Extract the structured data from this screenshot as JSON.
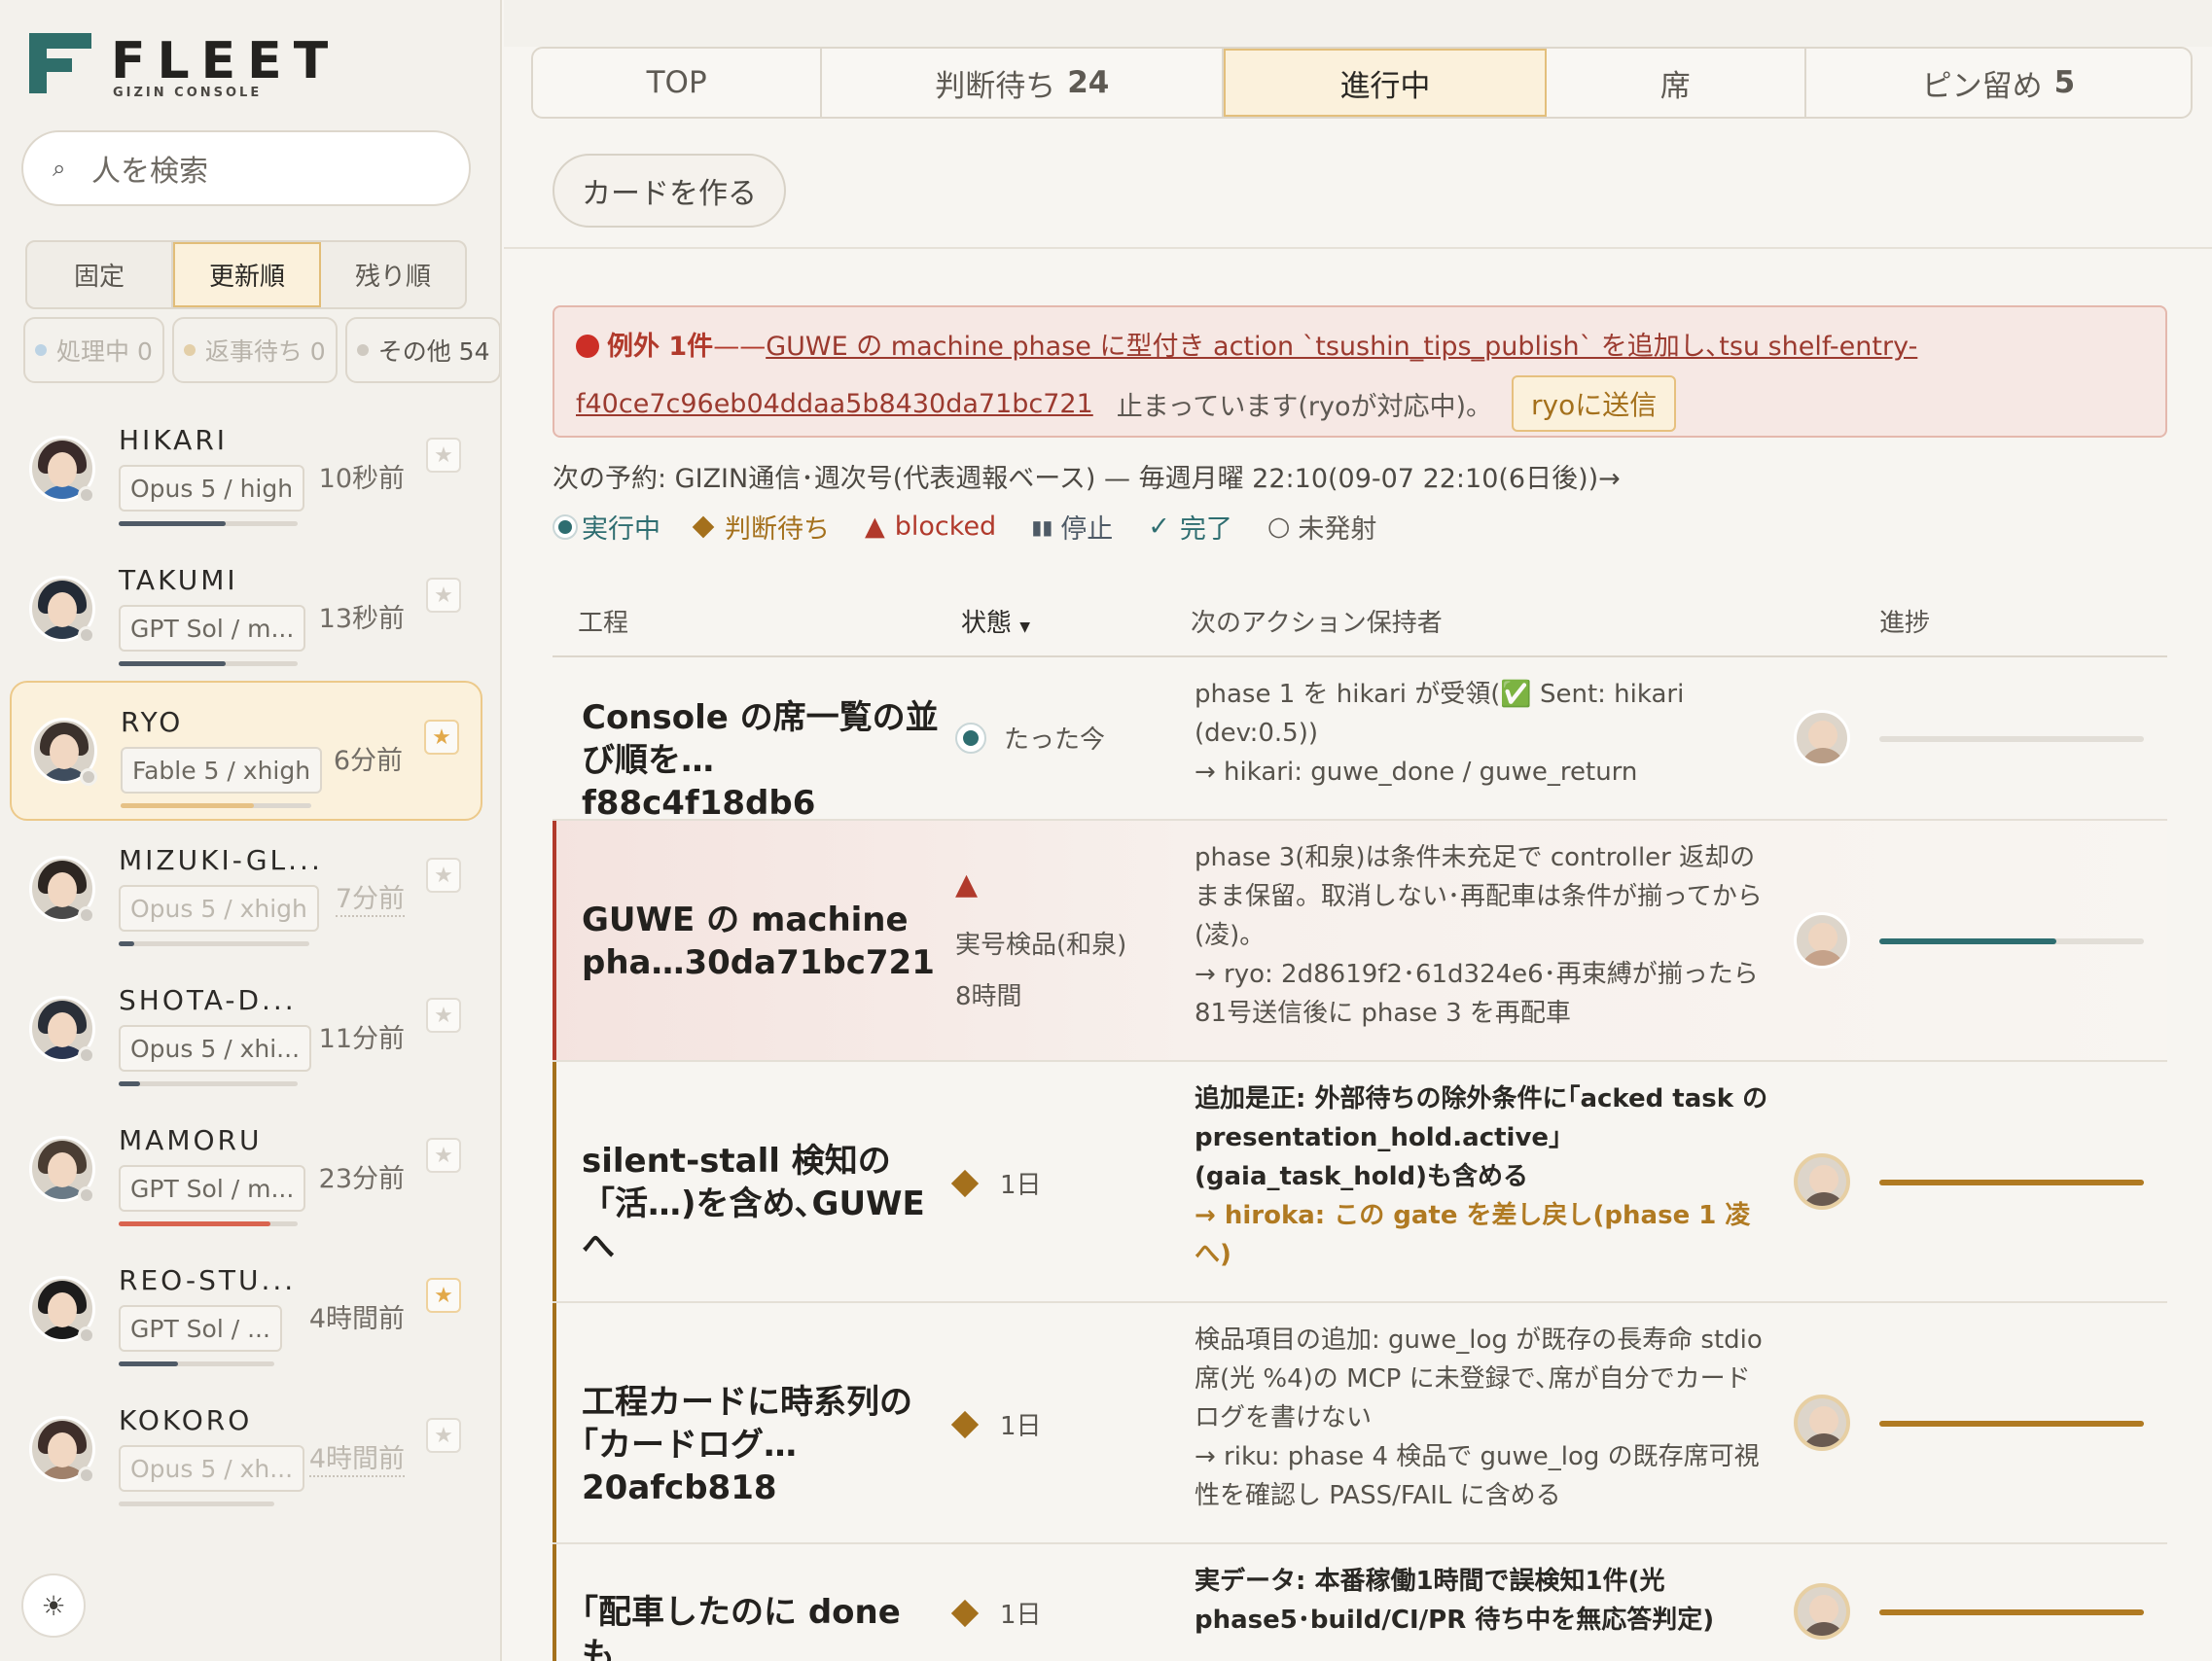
{
  "brand": {
    "name": "FLEET",
    "sub": "GIZIN CONSOLE"
  },
  "sidebar": {
    "search_placeholder": "人を検索",
    "sort_tabs": [
      {
        "label": "固定",
        "active": false
      },
      {
        "label": "更新順",
        "active": true
      },
      {
        "label": "残り順",
        "active": false
      }
    ],
    "filters": [
      {
        "label": "処理中 0"
      },
      {
        "label": "返事待ち 0"
      },
      {
        "label": "その他 54"
      }
    ],
    "people": [
      {
        "name": "HIKARI",
        "model": "Opus 5 / high",
        "time": "10秒前",
        "progress": 0.6,
        "starred": false,
        "dim": false,
        "active": false,
        "bar_color": "#4f5a66"
      },
      {
        "name": "TAKUMI",
        "model": "GPT Sol / m...",
        "time": "13秒前",
        "progress": 0.6,
        "starred": false,
        "dim": false,
        "active": false,
        "bar_color": "#4f5a66"
      },
      {
        "name": "RYO",
        "model": "Fable 5 / xhigh",
        "time": "6分前",
        "progress": 0.7,
        "starred": true,
        "dim": false,
        "active": true,
        "bar_color": "#e6c185"
      },
      {
        "name": "MIZUKI-GL...",
        "model": "Opus 5 / xhigh",
        "time": "7分前",
        "progress": 0.08,
        "starred": false,
        "dim": true,
        "active": false,
        "bar_color": "#4f5a66"
      },
      {
        "name": "SHOTA-D...",
        "model": "Opus 5 / xhi...",
        "time": "11分前",
        "progress": 0.12,
        "starred": false,
        "dim": false,
        "active": false,
        "bar_color": "#4f5a66"
      },
      {
        "name": "MAMORU",
        "model": "GPT Sol / m...",
        "time": "23分前",
        "progress": 0.85,
        "starred": false,
        "dim": false,
        "active": false,
        "bar_color": "#d9644f"
      },
      {
        "name": "REO-STU...",
        "model": "GPT Sol / ...",
        "time": "4時間前",
        "progress": 0.38,
        "starred": true,
        "dim": false,
        "active": false,
        "bar_color": "#4f5a66"
      },
      {
        "name": "KOKORO",
        "model": "Opus 5 / xh...",
        "time": "4時間前",
        "progress": 0.0,
        "starred": false,
        "dim": true,
        "active": false,
        "bar_color": "#4f5a66"
      }
    ],
    "theme_icon": "sun-icon"
  },
  "tabs": [
    {
      "label": "TOP",
      "count": "",
      "active": false
    },
    {
      "label": "判断待ち",
      "count": "24",
      "active": false
    },
    {
      "label": "進行中",
      "count": "",
      "active": true
    },
    {
      "label": "席",
      "count": "",
      "active": false
    },
    {
      "label": "ピン留め",
      "count": "5",
      "active": false
    }
  ],
  "make_card_label": "カードを作る",
  "alert": {
    "title": "例外 1件",
    "dash": "——",
    "link_line1": "GUWE の machine phase に型付き action `tsushin_tips_publish` を追加し､tsu shelf-entry-",
    "link_line2": "f40ce7c96eb04ddaa5b8430da71bc721",
    "note": "止まっています(ryoが対応中)。",
    "button": "ryoに送信"
  },
  "schedule": "次の予約: GIZIN通信･週次号(代表週報ベース) — 毎週月曜 22:10(09-07 22:10(6日後))→",
  "legend": {
    "running": "実行中",
    "waiting": "判断待ち",
    "blocked": "blocked",
    "stopped": "停止",
    "done": "完了",
    "not_fired": "未発射"
  },
  "table": {
    "headers": {
      "step": "工程",
      "state": "状態",
      "owner": "次のアクション保持者",
      "progress": "進捗"
    },
    "rows": [
      {
        "title": "Console の席一覧の並び順を…f88c4f18db6",
        "state": "たった今",
        "state_kind": "running",
        "owner_line1": "phase 1 を hikari が受領(✅ Sent: hikari (dev:0.5))",
        "owner_line2": "→ hikari: guwe_done / guwe_return",
        "progress": 0.0
      },
      {
        "title": "GUWE の machine pha…30da71bc721",
        "state": "実号検品(和泉)",
        "state_time": "8時間",
        "state_kind": "blocked",
        "owner_line1": "phase 3(和泉)は条件未充足で controller 返却のまま保留。取消しない･再配車は条件が揃ってから(凌)。",
        "owner_line2": "→ ryo: 2d8619f2･61d324e6･再束縛が揃ったら81号送信後に phase 3 を再配車",
        "progress": 0.67
      },
      {
        "title": "silent-stall 検知の「活…)を含め､GUWE へ",
        "state": "1日",
        "state_kind": "waiting",
        "owner_line1": "追加是正: 外部待ちの除外条件に｢acked task の presentation_hold.active｣(gaia_task_hold)も含める",
        "owner_line2": "→ hiroka: この gate を差し戻し(phase 1 凌へ)",
        "progress": 1.0
      },
      {
        "title": "工程カードに時系列の｢カードログ…20afcb818",
        "state": "1日",
        "state_kind": "waiting",
        "owner_line1": "検品項目の追加: guwe_log が既存の長寿命 stdio 席(光 %4)の MCP に未登録で､席が自分でカードログを書けない",
        "owner_line2": "→ riku: phase 4 検品で guwe_log の既存席可視性を確認し PASS/FAIL に含める",
        "progress": 1.0
      },
      {
        "title": "｢配車したのに done も",
        "state": "1日",
        "state_kind": "waiting",
        "owner_line1": "実データ: 本番稼働1時間で誤検知1件(光 phase5･build/CI/PR 待ち中を無応答判定)",
        "owner_line2": "",
        "progress": 1.0
      }
    ]
  }
}
